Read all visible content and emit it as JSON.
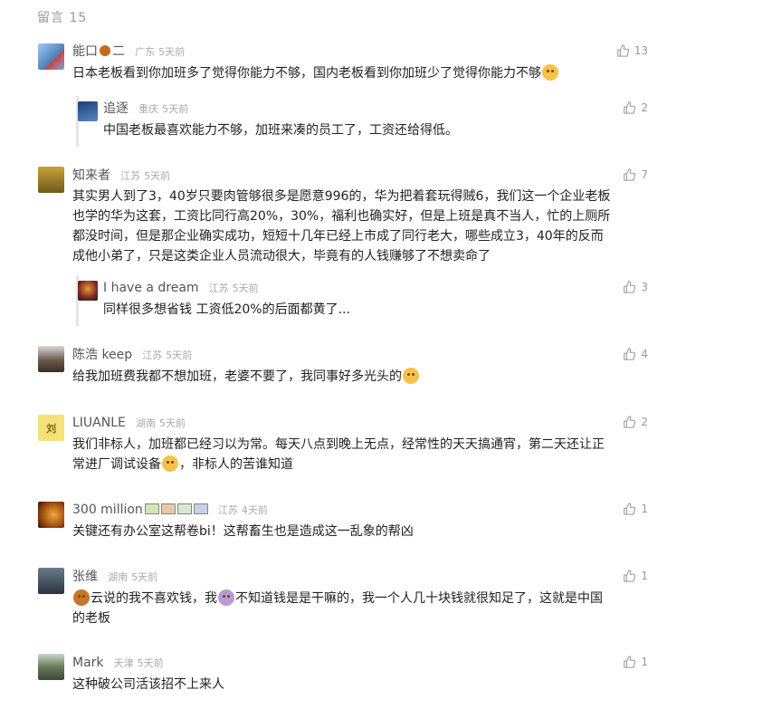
{
  "header": {
    "title": "留言 15"
  },
  "comments": [
    {
      "nickname": "能口",
      "nick_suffix": "二",
      "location": "广东",
      "time": "5天前",
      "likes": "13",
      "text": "日本老板看到你加班多了觉得你能力不够，国内老板看到你加班少了觉得你能力不够",
      "reply": {
        "nickname": "追逐",
        "location": "重庆",
        "time": "5天前",
        "likes": "2",
        "text": "中国老板最喜欢能力不够，加班来凑的员工了，工资还给得低。"
      }
    },
    {
      "nickname": "知来者",
      "location": "江苏",
      "time": "5天前",
      "likes": "7",
      "text_lines": [
        "其实男人到了3，40岁只要肉管够很多是愿意996的，华为把着套玩得贼6，我们这一个企业老板",
        "也学的华为这套，工资比同行高20%，30%，福利也确实好，但是上班是真不当人，忙的上厕所",
        "都没时间，但是那企业确实成功，短短十几年已经上市成了同行老大，哪些成立3，40年的反而",
        "成他小弟了，只是这类企业人员流动很大，毕竟有的人钱赚够了不想卖命了"
      ],
      "reply": {
        "nickname": "I have a dream",
        "location": "江苏",
        "time": "5天前",
        "likes": "3",
        "text": "同样很多想省钱 工资低20%的后面都黄了..."
      }
    },
    {
      "nickname": "陈浩 keep",
      "location": "江苏",
      "time": "5天前",
      "likes": "4",
      "text": "给我加班费我都不想加班，老婆不要了，我同事好多光头的"
    },
    {
      "nickname": "LIUANLE",
      "location": "湖南",
      "time": "5天前",
      "likes": "2",
      "text_lines": [
        "我们非标人，加班都已经习以为常。每天八点到晚上无点，经常性的天天搞通宵，第二天还让正",
        "常进厂调试设备",
        "，非标人的苦谁知道"
      ]
    },
    {
      "nickname": "300 million",
      "location": "江苏",
      "time": "4天前",
      "likes": "1",
      "text": "关键还有办公室这帮卷bi！这帮畜生也是造成这一乱象的帮凶"
    },
    {
      "nickname": "张维",
      "location": "湖南",
      "time": "5天前",
      "likes": "1",
      "text_lines": [
        "云说的我不喜欢钱，我",
        "不知道钱是是干嘛的，我一个人几十块钱就很知足了，这就是中国",
        "的老板"
      ]
    },
    {
      "nickname": "Mark",
      "location": "天津",
      "time": "5天前",
      "likes": "1",
      "text": "这种破公司活该招不上来人"
    }
  ]
}
